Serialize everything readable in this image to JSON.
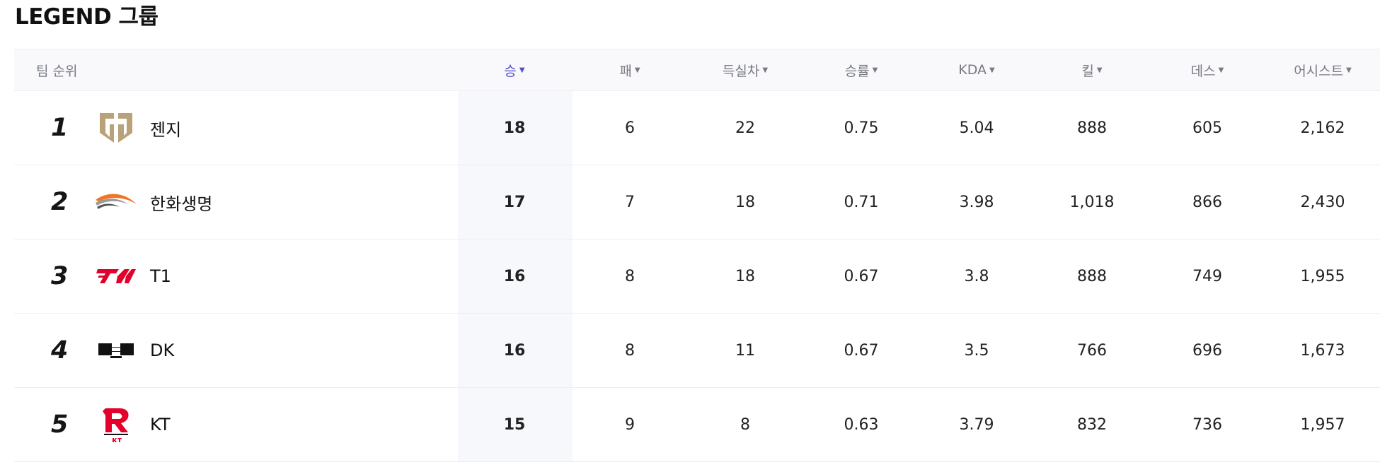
{
  "group_title": "LEGEND 그룹",
  "headers": {
    "team": "팀 순위",
    "wins": "승",
    "losses": "패",
    "diff": "득실차",
    "winrate": "승률",
    "kda": "KDA",
    "kills": "킬",
    "deaths": "데스",
    "assists": "어시스트"
  },
  "sort_caret": "▼",
  "active_sort": "wins",
  "colors": {
    "active_header": "#4b4fc8",
    "header_text": "#777a82",
    "header_bg": "#f9f9fc",
    "highlight_col": "#f7f8fc"
  },
  "rows": [
    {
      "rank": "1",
      "team": "젠지",
      "logo": "gen-g-logo",
      "wins": "18",
      "losses": "6",
      "diff": "22",
      "winrate": "0.75",
      "kda": "5.04",
      "kills": "888",
      "deaths": "605",
      "assists": "2,162"
    },
    {
      "rank": "2",
      "team": "한화생명",
      "logo": "hanwha-life-logo",
      "wins": "17",
      "losses": "7",
      "diff": "18",
      "winrate": "0.71",
      "kda": "3.98",
      "kills": "1,018",
      "deaths": "866",
      "assists": "2,430"
    },
    {
      "rank": "3",
      "team": "T1",
      "logo": "t1-logo",
      "wins": "16",
      "losses": "8",
      "diff": "18",
      "winrate": "0.67",
      "kda": "3.8",
      "kills": "888",
      "deaths": "749",
      "assists": "1,955"
    },
    {
      "rank": "4",
      "team": "DK",
      "logo": "dk-logo",
      "wins": "16",
      "losses": "8",
      "diff": "11",
      "winrate": "0.67",
      "kda": "3.5",
      "kills": "766",
      "deaths": "696",
      "assists": "1,673"
    },
    {
      "rank": "5",
      "team": "KT",
      "logo": "kt-rolster-logo",
      "wins": "15",
      "losses": "9",
      "diff": "8",
      "winrate": "0.63",
      "kda": "3.79",
      "kills": "832",
      "deaths": "736",
      "assists": "1,957"
    }
  ]
}
